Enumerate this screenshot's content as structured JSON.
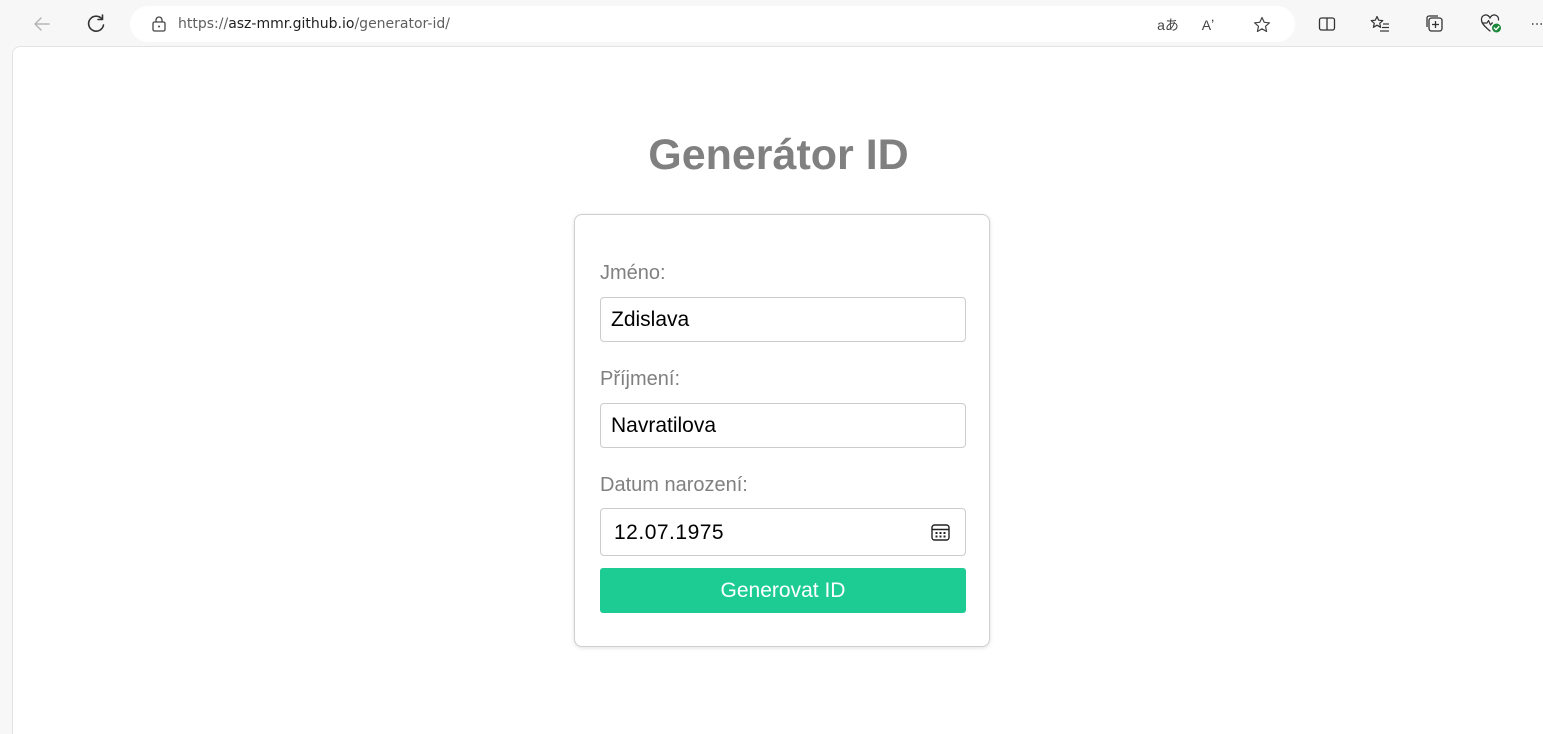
{
  "browser": {
    "url_scheme": "https://",
    "url_host": "asz-mmr.github.io",
    "url_path": "/generator-id/",
    "read_aloud_label": "Aʼ",
    "translate_label": "aあ"
  },
  "page": {
    "title": "Generátor ID"
  },
  "form": {
    "first_name_label": "Jméno:",
    "first_name_value": "Zdislava",
    "last_name_label": "Příjmení:",
    "last_name_value": "Navratilova",
    "birthdate_label": "Datum narození:",
    "birthdate_value": "12.07.1975",
    "submit_label": "Generovat ID"
  },
  "colors": {
    "accent": "#1ccc93",
    "title": "#808080",
    "label": "#808080"
  },
  "icons": {
    "back": "back-arrow-icon",
    "refresh": "refresh-icon",
    "lock": "lock-icon",
    "calendar": "calendar-icon"
  }
}
